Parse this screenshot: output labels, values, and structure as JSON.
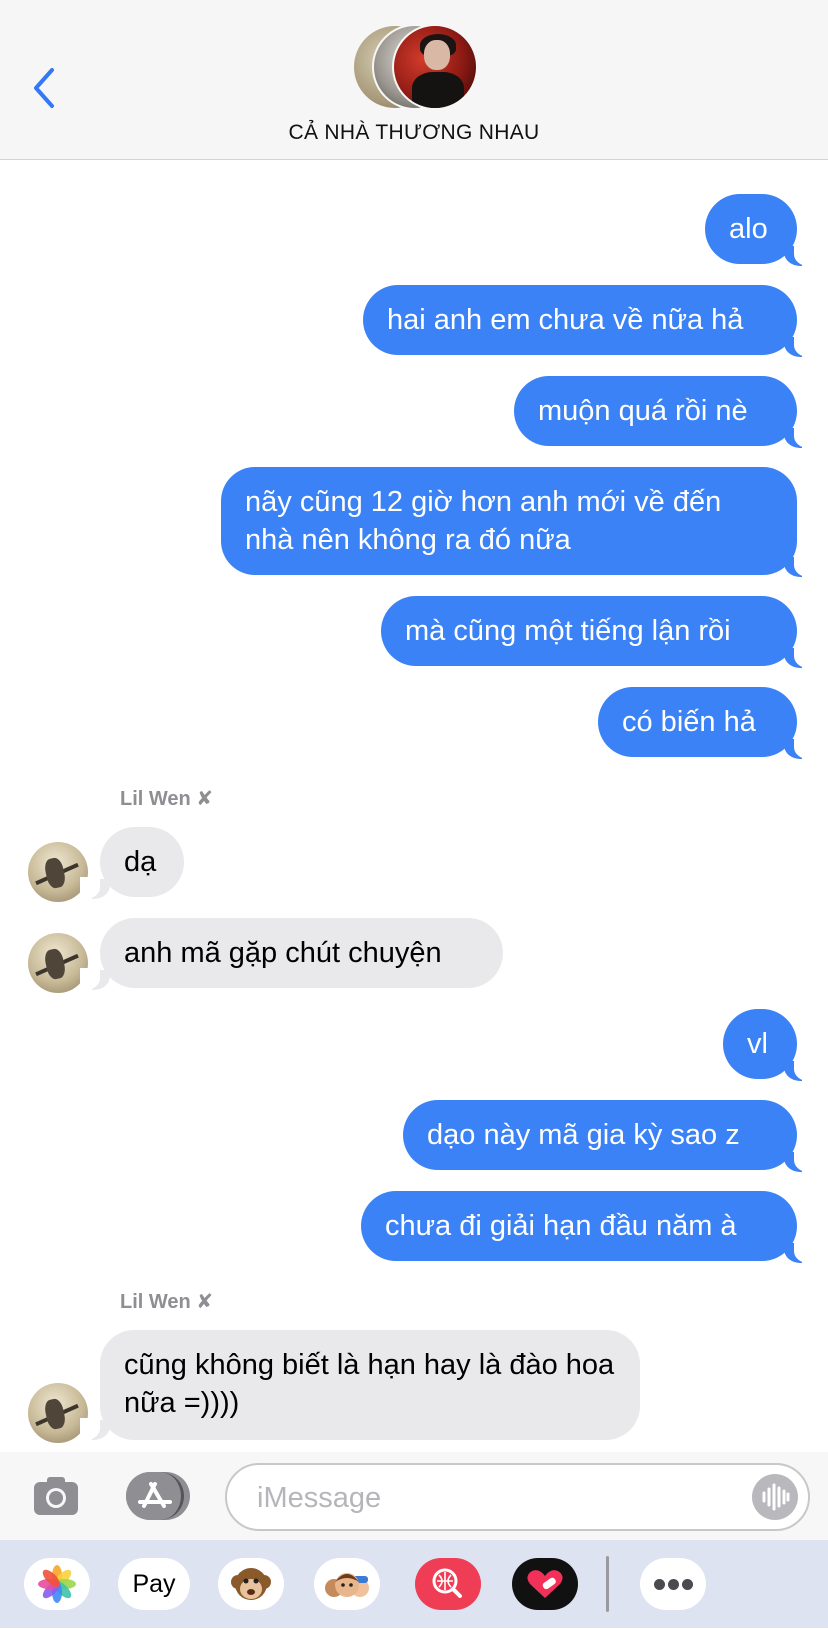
{
  "header": {
    "title": "CẢ NHÀ THƯƠNG NHAU"
  },
  "messages": [
    {
      "dir": "out",
      "text": "alo"
    },
    {
      "dir": "out",
      "text": "hai anh em chưa về nữa hả"
    },
    {
      "dir": "out",
      "text": "muộn quá rồi nè"
    },
    {
      "dir": "out",
      "text": "nãy cũng 12 giờ hơn anh mới về đến nhà nên không ra đó nữa"
    },
    {
      "dir": "out",
      "text": "mà cũng một tiếng lận rồi"
    },
    {
      "dir": "out",
      "text": "có biến hả"
    },
    {
      "dir": "in",
      "sender": "Lil Wen ✘",
      "text": "dạ"
    },
    {
      "dir": "in",
      "text": "anh mã gặp chút chuyện"
    },
    {
      "dir": "out",
      "text": "vl"
    },
    {
      "dir": "out",
      "text": "dạo này mã gia kỳ sao z"
    },
    {
      "dir": "out",
      "text": "chưa đi giải hạn đầu năm à"
    },
    {
      "dir": "in",
      "sender": "Lil Wen ✘",
      "text": "cũng không biết là hạn hay là đào hoa nữa =))))"
    }
  ],
  "compose": {
    "placeholder": "iMessage"
  },
  "tray": {
    "apple_pay_label": "Pay",
    "apple_pay_logo": "",
    "apps": [
      "photos-icon",
      "apple-pay-icon",
      "animoji-icon",
      "memoji-icon",
      "image-search-icon",
      "digital-touch-icon",
      "more-icon"
    ]
  },
  "colors": {
    "outgoing_bubble": "#3a82f6",
    "incoming_bubble": "#e9e9eb",
    "accent": "#3478f6"
  }
}
